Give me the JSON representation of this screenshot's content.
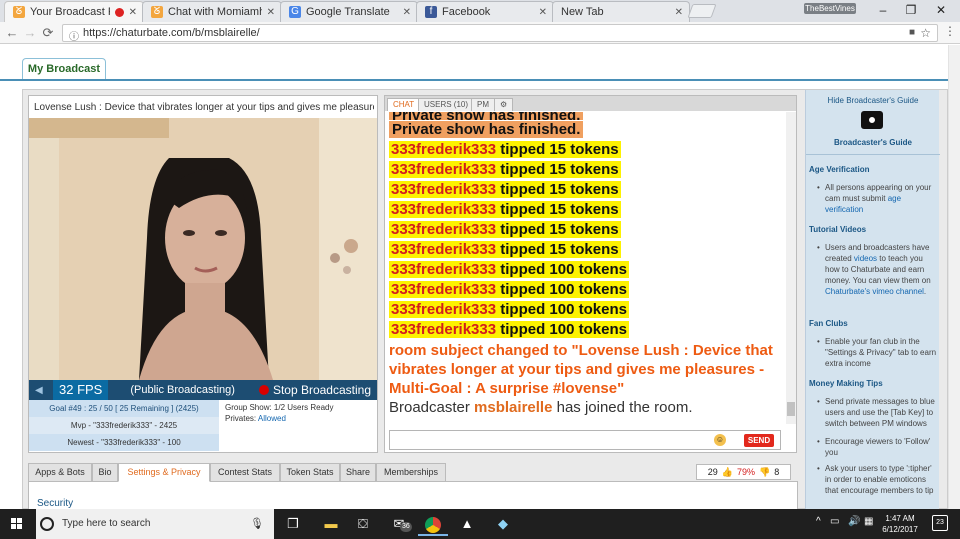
{
  "browser": {
    "tabs": [
      {
        "title": "Your Broadcast Page!",
        "favicon": "chaturbate-icon"
      },
      {
        "title": "Chat with Momiamhere",
        "favicon": "chaturbate-icon"
      },
      {
        "title": "Google Translate",
        "favicon": "translate-icon"
      },
      {
        "title": "Facebook",
        "favicon": "facebook-icon"
      },
      {
        "title": "New Tab",
        "favicon": ""
      }
    ],
    "corner_brand": "TheBestVines",
    "url": "https://chaturbate.com/b/msblairelle/"
  },
  "page": {
    "my_broadcast_tab": "My Broadcast",
    "video": {
      "title": "Lovense Lush : Device that vibrates longer at your tips and gives me pleasures - Multi-",
      "fps": "32 FPS",
      "status": "(Public Broadcasting)",
      "stop_label": "Stop Broadcasting",
      "goal": "Goal #49 : 25 / 50 [ 25 Remaining ] (2425)",
      "mvp": "Mvp - \"333frederik333\" - 2425",
      "newest": "Newest - \"333frederik333\" - 100",
      "group_show": "Group Show: 1/2 Users Ready",
      "privates_label": "Privates:",
      "privates_value": "Allowed"
    },
    "chat": {
      "tabs": [
        "CHAT",
        "USERS (10)",
        "PM"
      ],
      "partial_line": "Private show has finished.",
      "private_finished": "Private show has finished.",
      "tips": [
        {
          "user": "333frederik333",
          "text": "tipped 15 tokens"
        },
        {
          "user": "333frederik333",
          "text": "tipped 15 tokens"
        },
        {
          "user": "333frederik333",
          "text": "tipped 15 tokens"
        },
        {
          "user": "333frederik333",
          "text": "tipped 15 tokens"
        },
        {
          "user": "333frederik333",
          "text": "tipped 15 tokens"
        },
        {
          "user": "333frederik333",
          "text": "tipped 15 tokens"
        },
        {
          "user": "333frederik333",
          "text": "tipped 100 tokens"
        },
        {
          "user": "333frederik333",
          "text": "tipped 100 tokens"
        },
        {
          "user": "333frederik333",
          "text": "tipped 100 tokens"
        },
        {
          "user": "333frederik333",
          "text": "tipped 100 tokens"
        }
      ],
      "room_subject": "room subject changed to \"Lovense Lush : Device that vibrates longer at your tips and gives me pleasures - Multi-Goal : A surprise #lovense\"",
      "broadcaster_prefix": "Broadcaster",
      "broadcaster_name": "msblairelle",
      "broadcaster_suffix": "has joined the room.",
      "send_label": "SEND"
    },
    "sidebar": {
      "hide_guide": "Hide Broadcaster's Guide",
      "guide_title": "Broadcaster's Guide",
      "age_heading": "Age Verification",
      "age_text": "All persons appearing on your cam must submit",
      "age_link": "age verification",
      "tutorial_heading": "Tutorial Videos",
      "tutorial_text_1": "Users and broadcasters have created",
      "tutorial_link_1": "videos",
      "tutorial_text_2": "to teach you how to Chaturbate and earn money. You can view them on",
      "tutorial_link_2": "Chaturbate's vimeo channel",
      "fan_heading": "Fan Clubs",
      "fan_text": "Enable your fan club in the \"Settings & Privacy\" tab to earn extra income",
      "money_heading": "Money Making Tips",
      "money_tips": [
        "Send private messages to blue users and use the [Tab Key] to switch between PM windows",
        "Encourage viewers to 'Follow' you",
        "Ask your users to type ':tipher' in order to enable emoticons that encourage members to tip"
      ]
    },
    "bottom_tabs": [
      "Apps & Bots",
      "Bio",
      "Settings & Privacy",
      "Contest Stats",
      "Token Stats",
      "Share",
      "Memberships"
    ],
    "active_bottom_tab": "Settings & Privacy",
    "security_label": "Security",
    "rating": {
      "up": "29",
      "percent": "79%",
      "down": "8"
    }
  },
  "taskbar": {
    "search_placeholder": "Type here to search",
    "time": "1:47 AM",
    "date": "6/12/2017",
    "notifications": "23",
    "mail_badge": "36"
  },
  "colors": {
    "tip_highlight": "#fdf200",
    "tip_user": "#d31d1d",
    "room_subject": "#ee5b12",
    "brand_blue": "#1d4d72"
  }
}
